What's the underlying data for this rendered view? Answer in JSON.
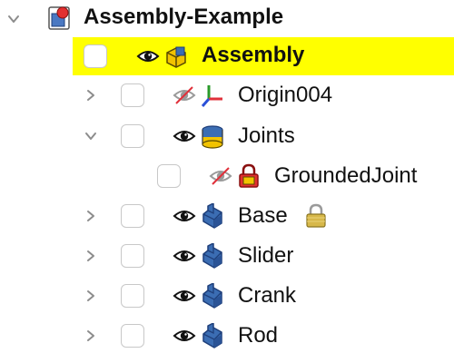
{
  "tree": {
    "root": {
      "label": "Assembly-Example",
      "icon": "freecad-document-icon",
      "expanded": true
    },
    "items": [
      {
        "label": "Assembly",
        "icon": "assembly-icon",
        "visibility": "visible",
        "expanded": true,
        "highlighted": true,
        "checked": false
      },
      {
        "label": "Origin004",
        "icon": "origin-axes-icon",
        "visibility": "hidden",
        "expanded": false,
        "checked": false
      },
      {
        "label": "Joints",
        "icon": "joints-group-icon",
        "visibility": "visible",
        "expanded": true,
        "checked": false
      },
      {
        "label": "GroundedJoint",
        "icon": "grounded-joint-lock-icon",
        "visibility": "hidden",
        "checked": false
      },
      {
        "label": "Base",
        "icon": "part-body-icon",
        "visibility": "visible",
        "expanded": false,
        "locked": true,
        "checked": false
      },
      {
        "label": "Slider",
        "icon": "part-body-icon",
        "visibility": "visible",
        "expanded": false,
        "checked": false
      },
      {
        "label": "Crank",
        "icon": "part-body-icon",
        "visibility": "visible",
        "expanded": false,
        "checked": false
      },
      {
        "label": "Rod",
        "icon": "part-body-icon",
        "visibility": "visible",
        "expanded": false,
        "checked": false
      }
    ]
  },
  "colors": {
    "selection_highlight": "#ffff00",
    "part_blue": "#3b6db3",
    "joint_yellow": "#f2c300",
    "hidden_slash": "#e0303a",
    "chevron": "#8c8c8c"
  }
}
